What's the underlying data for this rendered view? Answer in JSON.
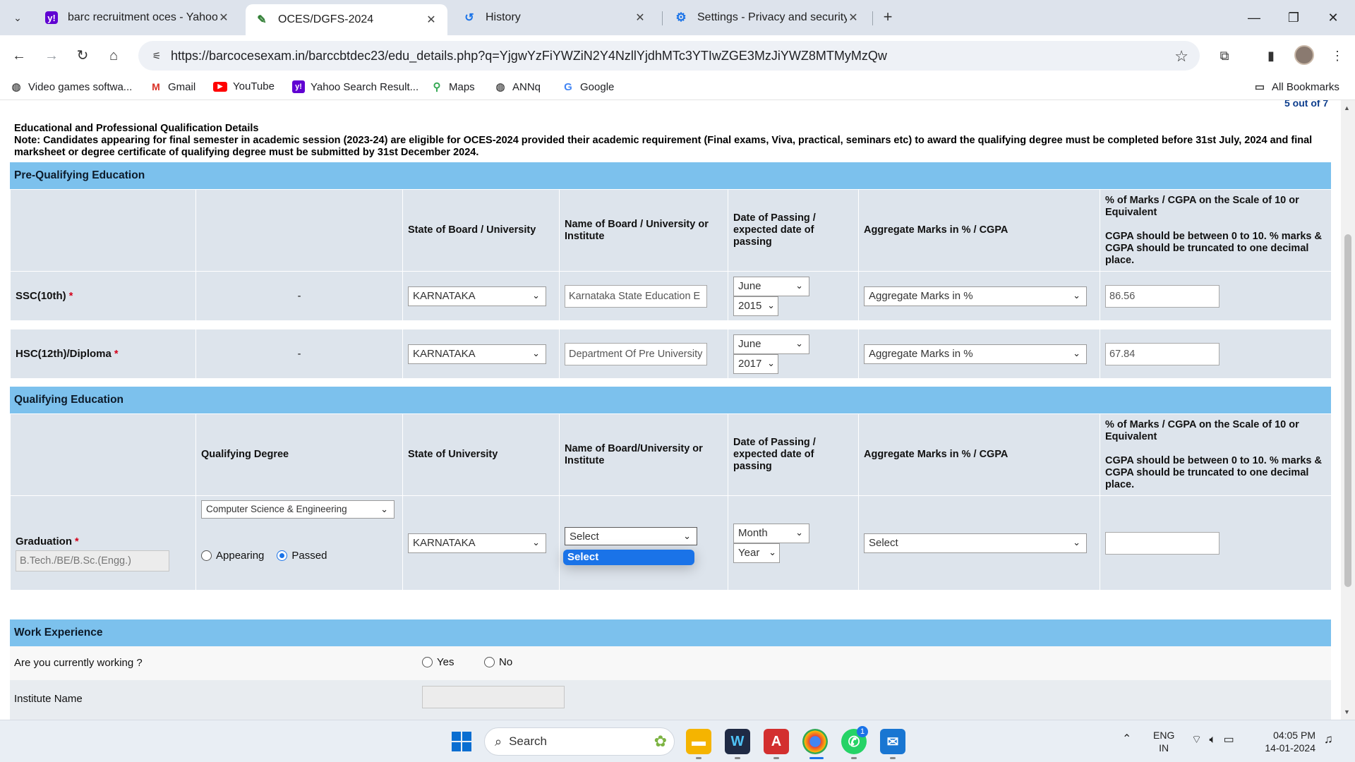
{
  "browser": {
    "tabs": [
      {
        "title": "barc recruitment oces - Yahoo I",
        "icon": "yahoo-icon",
        "active": false
      },
      {
        "title": "OCES/DGFS-2024",
        "icon": "form-icon",
        "active": true
      },
      {
        "title": "History",
        "icon": "history-icon",
        "active": false
      },
      {
        "title": "Settings - Privacy and security",
        "icon": "gear-icon",
        "active": false
      }
    ],
    "url": "https://barcocesexam.in/barccbtdec23/edu_details.php?q=YjgwYzFiYWZiN2Y4NzllYjdhMTc3YTIwZGE3MzJiYWZ8MTMyMzQw",
    "bookmarks": [
      {
        "label": "Video games softwa...",
        "icon": "globe-icon"
      },
      {
        "label": "Gmail",
        "icon": "gmail-icon"
      },
      {
        "label": "YouTube",
        "icon": "youtube-icon"
      },
      {
        "label": "Yahoo Search Result...",
        "icon": "yahoo-icon"
      },
      {
        "label": "Maps",
        "icon": "maps-icon"
      },
      {
        "label": "ANNq",
        "icon": "globe-icon"
      },
      {
        "label": "Google",
        "icon": "google-icon"
      }
    ],
    "all_bookmarks": "All Bookmarks",
    "page_count": "5 out of 7"
  },
  "page": {
    "title": "Educational and Professional Qualification Details",
    "note": "Note: Candidates appearing for final semester in academic session (2023-24) are eligible for OCES-2024 provided their academic requirement (Final exams, Viva, practical, seminars etc) to award the qualifying degree must be completed before 31st July, 2024 and final marksheet or degree certificate of qualifying degree must be submitted by 31st December 2024.",
    "pre_qualifying": {
      "section_title": "Pre-Qualifying Education",
      "headers": {
        "state": "State of Board / University",
        "name": "Name of Board / University or Institute",
        "date": "Date of Passing / expected date of passing",
        "aggregate": "Aggregate Marks in % / CGPA",
        "marks_line1": "% of Marks / CGPA on the Scale of 10 or Equivalent",
        "marks_line2": "CGPA should be between 0 to 10. % marks & CGPA should be truncated to one decimal place."
      },
      "rows": [
        {
          "label": "SSC(10th)",
          "degree": "-",
          "state": "KARNATAKA",
          "board": "Karnataka State Education E",
          "month": "June",
          "year": "2015",
          "aggregate": "Aggregate Marks in %",
          "marks": "86.56"
        },
        {
          "label": "HSC(12th)/Diploma",
          "degree": "-",
          "state": "KARNATAKA",
          "board": "Department Of Pre University",
          "month": "June",
          "year": "2017",
          "aggregate": "Aggregate Marks in %",
          "marks": "67.84"
        }
      ]
    },
    "qualifying": {
      "section_title": "Qualifying Education",
      "headers": {
        "degree": "Qualifying Degree",
        "state": "State of University",
        "name": "Name of Board/University or Institute",
        "date": "Date of Passing / expected date of passing",
        "aggregate": "Aggregate Marks in % / CGPA",
        "marks_line1": "% of Marks / CGPA on the Scale of 10 or Equivalent",
        "marks_line2": "CGPA should be between 0 to 10. % marks & CGPA should be truncated to one decimal place."
      },
      "row": {
        "label": "Graduation",
        "degree_placeholder": "B.Tech./BE/B.Sc.(Engg.)",
        "branch": "Computer Science & Engineering",
        "appearing": "Appearing",
        "passed": "Passed",
        "state": "KARNATAKA",
        "board": "Select",
        "board_option": "Select",
        "month": "Month",
        "year": "Year",
        "aggregate": "Select",
        "marks": ""
      }
    },
    "work": {
      "section_title": "Work Experience",
      "question": "Are you currently working ?",
      "yes": "Yes",
      "no": "No",
      "institute_label": "Institute Name"
    }
  },
  "taskbar": {
    "search": "Search",
    "lang_line1": "ENG",
    "lang_line2": "IN",
    "time": "04:05 PM",
    "date": "14-01-2024",
    "whatsapp_badge": "1"
  },
  "colors": {
    "section_bar": "#7cc1ed",
    "cell_bg": "#dde4ec",
    "required": "#d4001a",
    "accent": "#1a73e8"
  }
}
